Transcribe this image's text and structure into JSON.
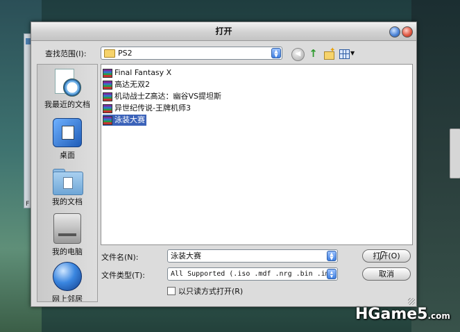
{
  "window": {
    "title": "打开"
  },
  "lookin": {
    "label": "查找范围(I):",
    "value": "PS2"
  },
  "places": [
    {
      "label": "我最近的文档",
      "icon": "recent-documents-icon"
    },
    {
      "label": "桌面",
      "icon": "desktop-icon"
    },
    {
      "label": "我的文档",
      "icon": "my-documents-icon"
    },
    {
      "label": "我的电脑",
      "icon": "my-computer-icon"
    },
    {
      "label": "网上邻居",
      "icon": "network-places-icon"
    }
  ],
  "files": [
    {
      "name": "Final Fantasy X",
      "selected": false
    },
    {
      "name": "高达无双2",
      "selected": false
    },
    {
      "name": "机动战士Z高达：幽谷VS提坦斯",
      "selected": false
    },
    {
      "name": "异世纪传说-王牌机师3",
      "selected": false
    },
    {
      "name": "泳装大赛",
      "selected": true
    }
  ],
  "filename": {
    "label": "文件名(N):",
    "value": "泳装大赛"
  },
  "filetype": {
    "label": "文件类型(T):",
    "value": "All Supported (.iso .mdf .nrg .bin .im"
  },
  "readonly": {
    "label": "以只读方式打开(R)",
    "checked": false
  },
  "buttons": {
    "open": "打开(O)",
    "cancel": "取消"
  },
  "watermark": {
    "brand": "HGame5",
    "domain": ".com"
  },
  "background": {
    "stray_letter": "F"
  },
  "colors": {
    "selection": "#3b62b9",
    "title_bg": "#d2d2d2",
    "dialog_bg": "#dcdcdc"
  }
}
